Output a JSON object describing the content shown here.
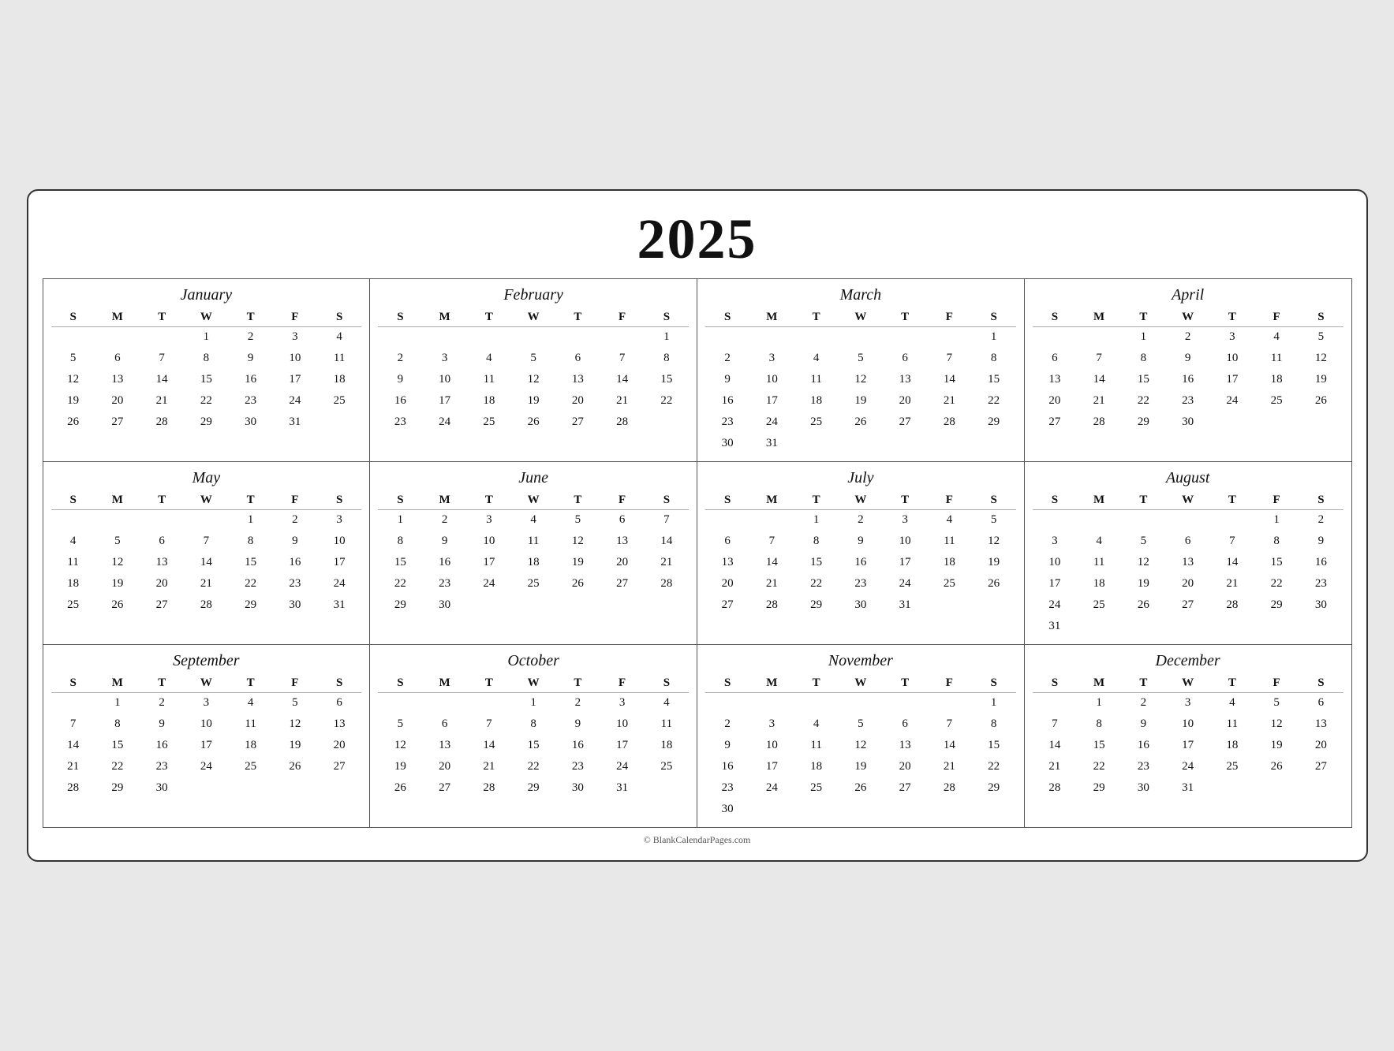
{
  "year": "2025",
  "footer": "© BlankCalendarPages.com",
  "months": [
    {
      "name": "January",
      "days": [
        [
          null,
          null,
          null,
          1,
          2,
          3,
          4
        ],
        [
          5,
          6,
          7,
          8,
          9,
          10,
          11
        ],
        [
          12,
          13,
          14,
          15,
          16,
          17,
          18
        ],
        [
          19,
          20,
          21,
          22,
          23,
          24,
          25
        ],
        [
          26,
          27,
          28,
          29,
          30,
          31,
          null
        ]
      ]
    },
    {
      "name": "February",
      "days": [
        [
          null,
          null,
          null,
          null,
          null,
          null,
          1
        ],
        [
          2,
          3,
          4,
          5,
          6,
          7,
          8
        ],
        [
          9,
          10,
          11,
          12,
          13,
          14,
          15
        ],
        [
          16,
          17,
          18,
          19,
          20,
          21,
          22
        ],
        [
          23,
          24,
          25,
          26,
          27,
          28,
          null
        ]
      ]
    },
    {
      "name": "March",
      "days": [
        [
          null,
          null,
          null,
          null,
          null,
          null,
          1
        ],
        [
          2,
          3,
          4,
          5,
          6,
          7,
          8
        ],
        [
          9,
          10,
          11,
          12,
          13,
          14,
          15
        ],
        [
          16,
          17,
          18,
          19,
          20,
          21,
          22
        ],
        [
          23,
          24,
          25,
          26,
          27,
          28,
          29
        ],
        [
          30,
          31,
          null,
          null,
          null,
          null,
          null
        ]
      ]
    },
    {
      "name": "April",
      "days": [
        [
          null,
          null,
          1,
          2,
          3,
          4,
          5
        ],
        [
          6,
          7,
          8,
          9,
          10,
          11,
          12
        ],
        [
          13,
          14,
          15,
          16,
          17,
          18,
          19
        ],
        [
          20,
          21,
          22,
          23,
          24,
          25,
          26
        ],
        [
          27,
          28,
          29,
          30,
          null,
          null,
          null
        ]
      ]
    },
    {
      "name": "May",
      "days": [
        [
          null,
          null,
          null,
          null,
          1,
          2,
          3
        ],
        [
          4,
          5,
          6,
          7,
          8,
          9,
          10
        ],
        [
          11,
          12,
          13,
          14,
          15,
          16,
          17
        ],
        [
          18,
          19,
          20,
          21,
          22,
          23,
          24
        ],
        [
          25,
          26,
          27,
          28,
          29,
          30,
          31
        ]
      ]
    },
    {
      "name": "June",
      "days": [
        [
          1,
          2,
          3,
          4,
          5,
          6,
          7
        ],
        [
          8,
          9,
          10,
          11,
          12,
          13,
          14
        ],
        [
          15,
          16,
          17,
          18,
          19,
          20,
          21
        ],
        [
          22,
          23,
          24,
          25,
          26,
          27,
          28
        ],
        [
          29,
          30,
          null,
          null,
          null,
          null,
          null
        ]
      ]
    },
    {
      "name": "July",
      "days": [
        [
          null,
          null,
          1,
          2,
          3,
          4,
          5
        ],
        [
          6,
          7,
          8,
          9,
          10,
          11,
          12
        ],
        [
          13,
          14,
          15,
          16,
          17,
          18,
          19
        ],
        [
          20,
          21,
          22,
          23,
          24,
          25,
          26
        ],
        [
          27,
          28,
          29,
          30,
          31,
          null,
          null
        ]
      ]
    },
    {
      "name": "August",
      "days": [
        [
          null,
          null,
          null,
          null,
          null,
          1,
          2
        ],
        [
          3,
          4,
          5,
          6,
          7,
          8,
          9
        ],
        [
          10,
          11,
          12,
          13,
          14,
          15,
          16
        ],
        [
          17,
          18,
          19,
          20,
          21,
          22,
          23
        ],
        [
          24,
          25,
          26,
          27,
          28,
          29,
          30
        ],
        [
          31,
          null,
          null,
          null,
          null,
          null,
          null
        ]
      ]
    },
    {
      "name": "September",
      "days": [
        [
          null,
          1,
          2,
          3,
          4,
          5,
          6
        ],
        [
          7,
          8,
          9,
          10,
          11,
          12,
          13
        ],
        [
          14,
          15,
          16,
          17,
          18,
          19,
          20
        ],
        [
          21,
          22,
          23,
          24,
          25,
          26,
          27
        ],
        [
          28,
          29,
          30,
          null,
          null,
          null,
          null
        ]
      ]
    },
    {
      "name": "October",
      "days": [
        [
          null,
          null,
          null,
          1,
          2,
          3,
          4
        ],
        [
          5,
          6,
          7,
          8,
          9,
          10,
          11
        ],
        [
          12,
          13,
          14,
          15,
          16,
          17,
          18
        ],
        [
          19,
          20,
          21,
          22,
          23,
          24,
          25
        ],
        [
          26,
          27,
          28,
          29,
          30,
          31,
          null
        ]
      ]
    },
    {
      "name": "November",
      "days": [
        [
          null,
          null,
          null,
          null,
          null,
          null,
          1
        ],
        [
          2,
          3,
          4,
          5,
          6,
          7,
          8
        ],
        [
          9,
          10,
          11,
          12,
          13,
          14,
          15
        ],
        [
          16,
          17,
          18,
          19,
          20,
          21,
          22
        ],
        [
          23,
          24,
          25,
          26,
          27,
          28,
          29
        ],
        [
          30,
          null,
          null,
          null,
          null,
          null,
          null
        ]
      ]
    },
    {
      "name": "December",
      "days": [
        [
          null,
          1,
          2,
          3,
          4,
          5,
          6
        ],
        [
          7,
          8,
          9,
          10,
          11,
          12,
          13
        ],
        [
          14,
          15,
          16,
          17,
          18,
          19,
          20
        ],
        [
          21,
          22,
          23,
          24,
          25,
          26,
          27
        ],
        [
          28,
          29,
          30,
          31,
          null,
          null,
          null
        ]
      ]
    }
  ],
  "day_headers": [
    "S",
    "M",
    "T",
    "W",
    "T",
    "F",
    "S"
  ]
}
